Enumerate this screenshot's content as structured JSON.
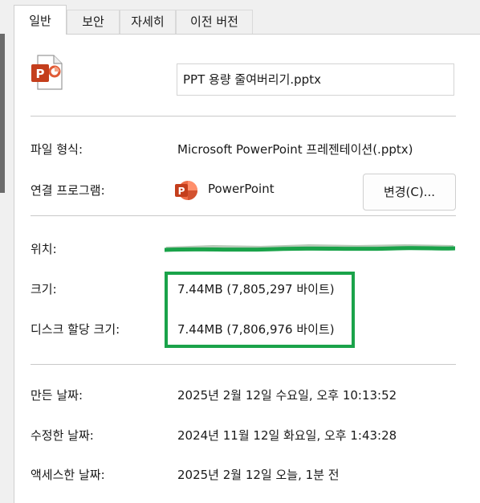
{
  "tabs": [
    {
      "label": "일반",
      "active": true
    },
    {
      "label": "보안",
      "active": false
    },
    {
      "label": "자세히",
      "active": false
    },
    {
      "label": "이전 버전",
      "active": false
    }
  ],
  "file": {
    "name": "PPT 용량 줄여버리기.pptx",
    "icon": "powerpoint-file-icon"
  },
  "details": {
    "type_label": "파일 형식:",
    "type_value": "Microsoft PowerPoint 프레젠테이션(.pptx)",
    "opens_with_label": "연결 프로그램:",
    "opens_with_app": "PowerPoint",
    "opens_with_icon": "powerpoint-app-icon",
    "change_button": "변경(C)...",
    "location_label": "위치:",
    "size_label": "크기:",
    "size_value": "7.44MB (7,805,297 바이트)",
    "size_on_disk_label": "디스크 할당 크기:",
    "size_on_disk_value": "7.44MB (7,806,976 바이트)",
    "created_label": "만든 날짜:",
    "created_value": "2025년 2월 12일 수요일, 오후 10:13:52",
    "modified_label": "수정한 날짜:",
    "modified_value": "2024년 11월 12일 화요일, 오후 1:43:28",
    "accessed_label": "액세스한 날짜:",
    "accessed_value": "2025년 2월 12일 오늘, 1분 전"
  },
  "annotations": {
    "highlight_color": "#1aa34a",
    "redaction_color": "#1aa34a"
  },
  "colors": {
    "ppt_orange": "#c43e1c",
    "ppt_light": "#f3a385"
  }
}
